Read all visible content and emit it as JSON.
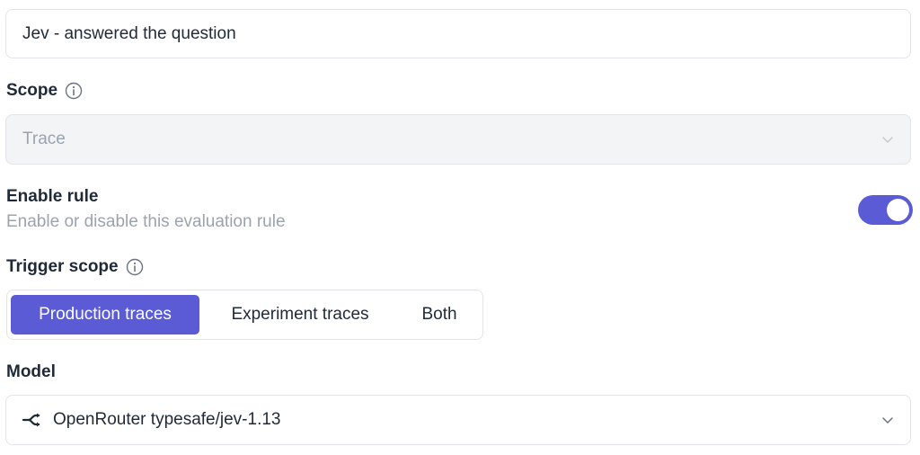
{
  "rule_name": {
    "value": "Jev - answered the question"
  },
  "scope": {
    "label": "Scope",
    "value": "Trace"
  },
  "enable_rule": {
    "title": "Enable rule",
    "description": "Enable or disable this evaluation rule",
    "enabled": true
  },
  "trigger_scope": {
    "label": "Trigger scope",
    "options": [
      "Production traces",
      "Experiment traces",
      "Both"
    ],
    "selected": "Production traces"
  },
  "model": {
    "label": "Model",
    "value": "OpenRouter typesafe/jev-1.13",
    "icon": "openrouter-icon"
  },
  "colors": {
    "accent": "#5b5bd6",
    "muted_text": "#9ca3af",
    "border": "#e2e4e9",
    "disabled_bg": "#f3f4f6"
  }
}
